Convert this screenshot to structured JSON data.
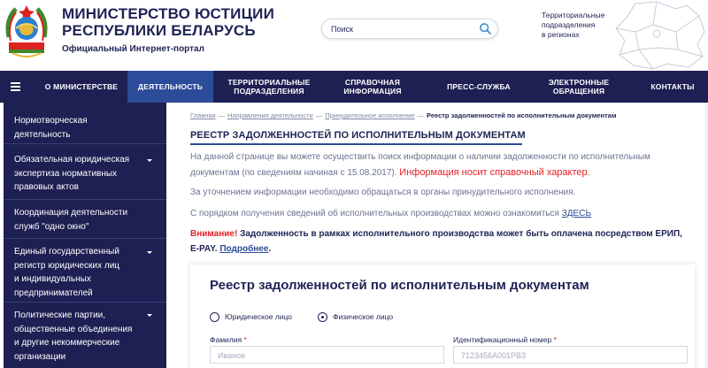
{
  "header": {
    "title_line1": "МИНИСТЕРСТВО ЮСТИЦИИ",
    "title_line2": "РЕСПУБЛИКИ БЕЛАРУСЬ",
    "subtitle": "Официальный Интернет-портал",
    "search_placeholder": "Поиск",
    "map_label_line1": "Территориальные",
    "map_label_line2": "подразделения",
    "map_label_line3": "в регионах"
  },
  "nav": {
    "items": [
      {
        "line1": "О МИНИСТЕРСТВЕ",
        "line2": ""
      },
      {
        "line1": "ДЕЯТЕЛЬНОСТЬ",
        "line2": ""
      },
      {
        "line1": "ТЕРРИТОРИАЛЬНЫЕ",
        "line2": "ПОДРАЗДЕЛЕНИЯ"
      },
      {
        "line1": "СПРАВОЧНАЯ",
        "line2": "ИНФОРМАЦИЯ"
      },
      {
        "line1": "ПРЕСС-СЛУЖБА",
        "line2": ""
      },
      {
        "line1": "ЭЛЕКТРОННЫЕ",
        "line2": "ОБРАЩЕНИЯ"
      },
      {
        "line1": "КОНТАКТЫ",
        "line2": ""
      }
    ]
  },
  "sidebar": {
    "items": [
      {
        "lines": [
          "Нормотворческая",
          "деятельность"
        ]
      },
      {
        "lines": [
          "Обязательная юридическая",
          "экспертиза нормативных",
          "правовых актов"
        ]
      },
      {
        "lines": [
          "Координация деятельности",
          "служб \"одно окно\""
        ]
      },
      {
        "lines": [
          "Единый государственный",
          "регистр юридических лиц",
          "и индивидуальных",
          "предпринимателей"
        ]
      },
      {
        "lines": [
          "Политические партии,",
          "общественные объединения",
          "и другие некоммерческие",
          "организации"
        ]
      }
    ]
  },
  "breadcrumb": {
    "home": "Главная",
    "sep": "—",
    "level1": "Направления деятельности",
    "level2": "Принудительное исполнение",
    "current": "Реестр задолженностей по исполнительным документам"
  },
  "main": {
    "title": "РЕЕСТР ЗАДОЛЖЕННОСТЕЙ ПО ИСПОЛНИТЕЛЬНЫМ ДОКУМЕНТАМ",
    "intro_line1": "На данной странице вы можете осуществить поиск информации о наличии задолженности по исполнительным",
    "intro_line2_a": "документам (по сведениям начиная с 15.08.2017).",
    "intro_line2_b": "Информация носит справочный характер.",
    "clarify": "За уточнением информации необходимо обращаться в органы принудительного исполнения.",
    "procedure": "С порядком получения сведений об исполнительных производствах можно ознакомиться",
    "procedure_link": "ЗДЕСЬ",
    "warning_label": "Внимание!",
    "warning_text": "Задолженность в рамках исполнительного производства может быть оплачена посредством ЕРИП,",
    "warning_text2": "E-PAY.",
    "warning_more": "Подробнее",
    "warning_end": "."
  },
  "form": {
    "title": "Реестр задолженностей по исполнительным документам",
    "radio_legal": "Юридическое лицо",
    "radio_person": "Физическое лицо",
    "selected": "Физическое лицо",
    "surname_label": "Фамилия",
    "surname_placeholder": "Иванов",
    "id_label": "Идентификационный номер",
    "id_placeholder": "7123456A001PB3",
    "required_mark": "*"
  },
  "colors": {
    "nav_bg": "#1e1f52",
    "nav_active": "#2c4b98",
    "accent_red": "#e32025"
  }
}
